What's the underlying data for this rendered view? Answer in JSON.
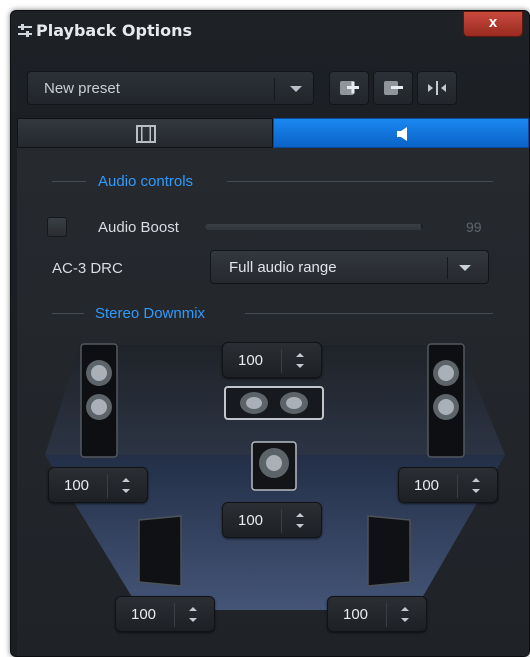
{
  "window": {
    "title": "Playback Options",
    "close_label": "x",
    "icons": {
      "title": "sliders-icon",
      "close": "close-icon"
    }
  },
  "toolbar": {
    "preset_value": "New preset",
    "buttons": [
      {
        "icon": "add-preset-icon"
      },
      {
        "icon": "remove-preset-icon"
      },
      {
        "icon": "split-icon"
      }
    ]
  },
  "tabs": [
    {
      "icon": "film-icon",
      "selected": false
    },
    {
      "icon": "speaker-icon",
      "selected": true
    }
  ],
  "audio_controls": {
    "section_title": "Audio controls",
    "audio_boost": {
      "label": "Audio Boost",
      "checked": false,
      "value": "99",
      "level": 0.99
    },
    "ac3_drc": {
      "label": "AC-3 DRC",
      "value": "Full audio range"
    }
  },
  "stereo_downmix": {
    "section_title": "Stereo Downmix",
    "channels": {
      "front_left": "100",
      "center": "100",
      "front_right": "100",
      "subwoofer": "100",
      "surround_left": "100",
      "surround_right": "100"
    }
  },
  "colors": {
    "accent": "#1a88f0",
    "section_title": "#2f9bff",
    "close_button": "#c0392b",
    "window_bg": "#1e2227"
  }
}
